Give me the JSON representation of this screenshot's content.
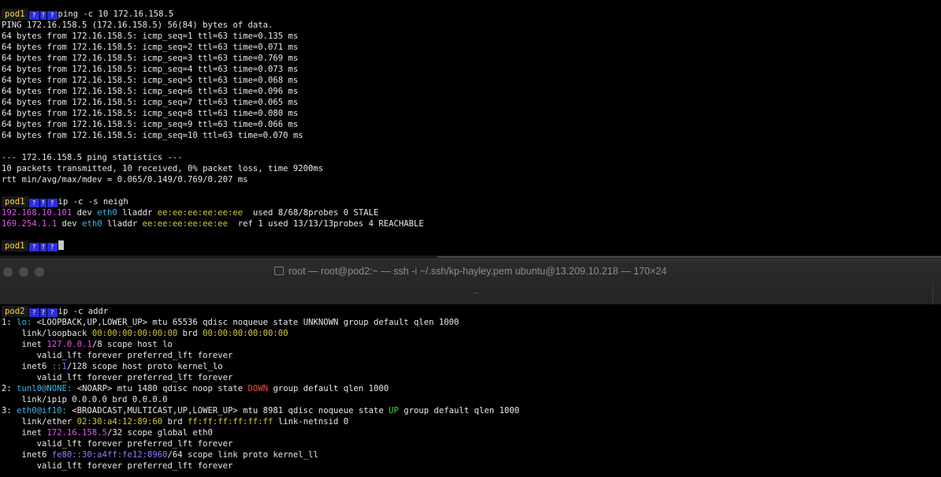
{
  "window": {
    "title": "root — root@pod2:~ — ssh -i ~/.ssh/kp-hayley.pem ubuntu@13.209.10.218 — 170×24",
    "tab_subtitle": "~"
  },
  "prompt_glyph": "?",
  "colors": {
    "magenta": "#e454f3",
    "cyan": "#3bb8e8",
    "yellow": "#d6c833",
    "red": "#ee4a3a",
    "green": "#3fd33f",
    "blue": "#8f7cff",
    "prompt_block": "#2d2dd6",
    "prompt_host": "#ffcf3f"
  },
  "top_terminal": {
    "lines": [
      {
        "prompt": "pod1",
        "segs": [
          {
            "t": "ping -c 10 172.16.158.5"
          }
        ]
      },
      {
        "segs": [
          {
            "t": "PING 172.16.158.5 (172.16.158.5) 56(84) bytes of data."
          }
        ]
      },
      {
        "segs": [
          {
            "t": "64 bytes from 172.16.158.5: icmp_seq=1 ttl=63 time=0.135 ms"
          }
        ]
      },
      {
        "segs": [
          {
            "t": "64 bytes from 172.16.158.5: icmp_seq=2 ttl=63 time=0.071 ms"
          }
        ]
      },
      {
        "segs": [
          {
            "t": "64 bytes from 172.16.158.5: icmp_seq=3 ttl=63 time=0.769 ms"
          }
        ]
      },
      {
        "segs": [
          {
            "t": "64 bytes from 172.16.158.5: icmp_seq=4 ttl=63 time=0.073 ms"
          }
        ]
      },
      {
        "segs": [
          {
            "t": "64 bytes from 172.16.158.5: icmp_seq=5 ttl=63 time=0.068 ms"
          }
        ]
      },
      {
        "segs": [
          {
            "t": "64 bytes from 172.16.158.5: icmp_seq=6 ttl=63 time=0.096 ms"
          }
        ]
      },
      {
        "segs": [
          {
            "t": "64 bytes from 172.16.158.5: icmp_seq=7 ttl=63 time=0.065 ms"
          }
        ]
      },
      {
        "segs": [
          {
            "t": "64 bytes from 172.16.158.5: icmp_seq=8 ttl=63 time=0.080 ms"
          }
        ]
      },
      {
        "segs": [
          {
            "t": "64 bytes from 172.16.158.5: icmp_seq=9 ttl=63 time=0.066 ms"
          }
        ]
      },
      {
        "segs": [
          {
            "t": "64 bytes from 172.16.158.5: icmp_seq=10 ttl=63 time=0.070 ms"
          }
        ]
      },
      {
        "segs": [
          {
            "t": ""
          }
        ]
      },
      {
        "segs": [
          {
            "t": "--- 172.16.158.5 ping statistics ---"
          }
        ]
      },
      {
        "segs": [
          {
            "t": "10 packets transmitted, 10 received, 0% packet loss, time 9200ms"
          }
        ]
      },
      {
        "segs": [
          {
            "t": "rtt min/avg/max/mdev = 0.065/0.149/0.769/0.207 ms"
          }
        ]
      },
      {
        "segs": [
          {
            "t": ""
          }
        ]
      },
      {
        "prompt": "pod1",
        "segs": [
          {
            "t": "ip -c -s neigh"
          }
        ]
      },
      {
        "segs": [
          {
            "t": "192.168.10.101",
            "c": "magenta"
          },
          {
            "t": " dev "
          },
          {
            "t": "eth0",
            "c": "cyan"
          },
          {
            "t": " lladdr "
          },
          {
            "t": "ee:ee:ee:ee:ee:ee",
            "c": "yellow"
          },
          {
            "t": "  used 8/68/8probes 0 STALE"
          }
        ]
      },
      {
        "segs": [
          {
            "t": "169.254.1.1",
            "c": "magenta"
          },
          {
            "t": " dev "
          },
          {
            "t": "eth0",
            "c": "cyan"
          },
          {
            "t": " lladdr "
          },
          {
            "t": "ee:ee:ee:ee:ee:ee",
            "c": "yellow"
          },
          {
            "t": "  ref 1 used 13/13/13probes 4 REACHABLE"
          }
        ]
      },
      {
        "segs": [
          {
            "t": ""
          }
        ]
      },
      {
        "prompt": "pod1",
        "cursor": true,
        "segs": []
      }
    ]
  },
  "bottom_terminal": {
    "lines": [
      {
        "prompt": "pod2",
        "segs": [
          {
            "t": "ip -c addr"
          }
        ]
      },
      {
        "segs": [
          {
            "t": "1: "
          },
          {
            "t": "lo:",
            "c": "cyan"
          },
          {
            "t": " <LOOPBACK,UP,LOWER_UP> mtu 65536 qdisc noqueue state UNKNOWN group default qlen 1000"
          }
        ]
      },
      {
        "segs": [
          {
            "t": "    link/loopback "
          },
          {
            "t": "00:00:00:00:00:00",
            "c": "yellow"
          },
          {
            "t": " brd "
          },
          {
            "t": "00:00:00:00:00:00",
            "c": "yellow"
          }
        ]
      },
      {
        "segs": [
          {
            "t": "    inet "
          },
          {
            "t": "127.0.0.1",
            "c": "magenta"
          },
          {
            "t": "/8 scope host lo"
          }
        ]
      },
      {
        "segs": [
          {
            "t": "       valid_lft forever preferred_lft forever"
          }
        ]
      },
      {
        "segs": [
          {
            "t": "    inet6 "
          },
          {
            "t": "::1",
            "c": "blue"
          },
          {
            "t": "/128 scope host proto kernel_lo"
          }
        ]
      },
      {
        "segs": [
          {
            "t": "       valid_lft forever preferred_lft forever"
          }
        ]
      },
      {
        "segs": [
          {
            "t": "2: "
          },
          {
            "t": "tunl0@NONE:",
            "c": "cyan"
          },
          {
            "t": " <NOARP> mtu 1480 qdisc noop state "
          },
          {
            "t": "DOWN",
            "c": "red"
          },
          {
            "t": " group default qlen 1000"
          }
        ]
      },
      {
        "segs": [
          {
            "t": "    link/ipip 0.0.0.0 brd 0.0.0.0"
          }
        ]
      },
      {
        "segs": [
          {
            "t": "3: "
          },
          {
            "t": "eth0@if10:",
            "c": "cyan"
          },
          {
            "t": " <BROADCAST,MULTICAST,UP,LOWER_UP> mtu 8981 qdisc noqueue state "
          },
          {
            "t": "UP",
            "c": "green"
          },
          {
            "t": " group default qlen 1000"
          }
        ]
      },
      {
        "segs": [
          {
            "t": "    link/ether "
          },
          {
            "t": "02:30:a4:12:89:60",
            "c": "yellow"
          },
          {
            "t": " brd "
          },
          {
            "t": "ff:ff:ff:ff:ff:ff",
            "c": "yellow"
          },
          {
            "t": " link-netnsid 0"
          }
        ]
      },
      {
        "segs": [
          {
            "t": "    inet "
          },
          {
            "t": "172.16.158.5",
            "c": "magenta"
          },
          {
            "t": "/32 scope global eth0"
          }
        ]
      },
      {
        "segs": [
          {
            "t": "       valid_lft forever preferred_lft forever"
          }
        ]
      },
      {
        "segs": [
          {
            "t": "    inet6 "
          },
          {
            "t": "fe80::30:a4ff:fe12:8960",
            "c": "blue"
          },
          {
            "t": "/64 scope link proto kernel_ll"
          }
        ]
      },
      {
        "segs": [
          {
            "t": "       valid_lft forever preferred_lft forever"
          }
        ]
      }
    ]
  }
}
